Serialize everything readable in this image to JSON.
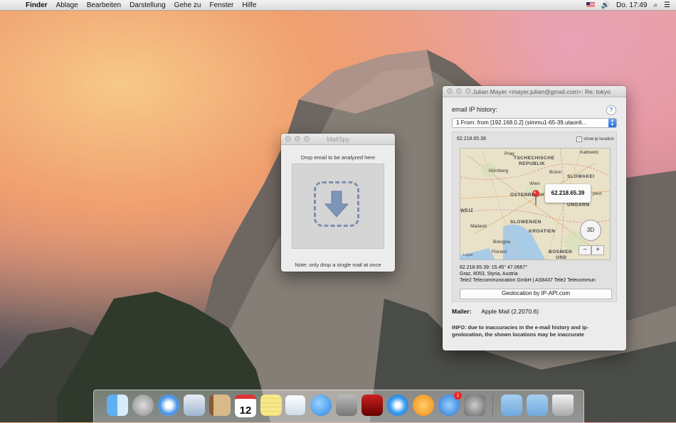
{
  "menubar": {
    "app_name": "Finder",
    "items": [
      "Ablage",
      "Bearbeiten",
      "Darstellung",
      "Gehe zu",
      "Fenster",
      "Hilfe"
    ],
    "clock": "Do. 17:49"
  },
  "mailspy": {
    "title": "MailSpy",
    "drop_label": "Drop email to be analyzed here",
    "note": "Note: only drop a single mail at once"
  },
  "main": {
    "title": "Julian Mayer <mayer.julian@gmail.com>: Re: tokyo",
    "history_label": "email IP history:",
    "help": "?",
    "selected_entry": "1 From:   from [192.168.0.2] (simmu1-65-39.utaonli...",
    "ip": "62.218.65.39",
    "show_ip_label": "show ip location",
    "map": {
      "callout": "62.218.65.39",
      "button_3d": "3D",
      "zoom_out": "−",
      "zoom_in": "+",
      "legal": "Legal",
      "labels": [
        "TSCHECHISCHE",
        "REPUBLIK",
        "Brünn",
        "Nürnberg",
        "SLOWAKEI",
        "Wien",
        "ÖSTERREICH",
        "pest",
        "UNGARN",
        "WEIZ",
        "Mailand",
        "SLOWENIEN",
        "KROATIEN",
        "Bologna",
        "Florenz",
        "BOSNIEN",
        "UND",
        "Prag",
        "Kattowitz"
      ]
    },
    "coords_line1": "62.218.65.39: 15.45° 47.0667°",
    "coords_line2": "Graz, 8053, Styria, Austria",
    "coords_line3": "Tele2 Telecommunication GmbH | AS8437 Tele2 Telecommun",
    "geo_button": "Geolocation by IP-API.com",
    "mailer_label": "Mailer:",
    "mailer_value": "Apple Mail (2.2070.6)",
    "info": "INFO: due to inaccuracies in the e-mail history and ip-geolocation, the shown locations may be inaccurate"
  },
  "dock": {
    "calendar_day": "12",
    "appstore_badge": "1",
    "icons": [
      "finder-icon",
      "launchpad-icon",
      "safari-icon",
      "mail-icon",
      "contacts-icon",
      "calendar-icon",
      "notes-icon",
      "preview-icon",
      "messages-icon",
      "facetime-icon",
      "photo-booth-icon",
      "itunes-icon",
      "ibooks-icon",
      "app-store-icon",
      "system-preferences-icon",
      "applications-folder-icon",
      "downloads-folder-icon",
      "trash-icon"
    ]
  }
}
